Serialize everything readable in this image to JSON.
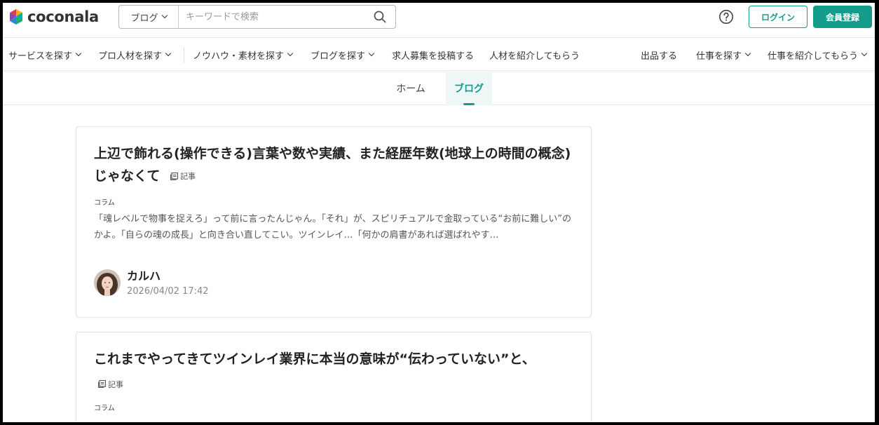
{
  "header": {
    "logo_text": "coconala",
    "search_category": "ブログ",
    "search_placeholder": "キーワードで検索",
    "login_label": "ログイン",
    "signup_label": "会員登録",
    "brand_color": "#159b8a"
  },
  "nav": {
    "items": [
      {
        "label": "サービスを探す",
        "dropdown": true
      },
      {
        "label": "プロ人材を探す",
        "dropdown": true
      },
      {
        "label": "ノウハウ・素材を探す",
        "dropdown": true
      },
      {
        "label": "ブログを探す",
        "dropdown": true
      },
      {
        "label": "求人募集を投稿する",
        "dropdown": false
      },
      {
        "label": "人材を紹介してもらう",
        "dropdown": false
      }
    ],
    "right_items": [
      {
        "label": "出品する",
        "dropdown": false
      },
      {
        "label": "仕事を探す",
        "dropdown": true
      },
      {
        "label": "仕事を紹介してもらう",
        "dropdown": true
      }
    ]
  },
  "tabs": [
    {
      "label": "ホーム",
      "active": false
    },
    {
      "label": "ブログ",
      "active": true
    }
  ],
  "posts": [
    {
      "title": "上辺で飾れる(操作できる)言葉や数や実績、また経歴年数(地球上の時間の概念)じゃなくて",
      "badge": "記事",
      "category": "コラム",
      "excerpt": "「魂レベルで物事を捉えろ」って前に言ったんじゃん。「それ」が、スピリチュアルで金取っている“お前に難しい”のかよ。「自らの魂の成長」と向き合い直してこい。ツインレイ…「何かの肩書があれば選ばれやす…",
      "author": "カルハ",
      "date": "2026/04/02 17:42"
    },
    {
      "title": "これまでやってきてツインレイ業界に本当の意味が“伝わっていない”と、",
      "badge": "記事",
      "category": "コラム"
    }
  ]
}
